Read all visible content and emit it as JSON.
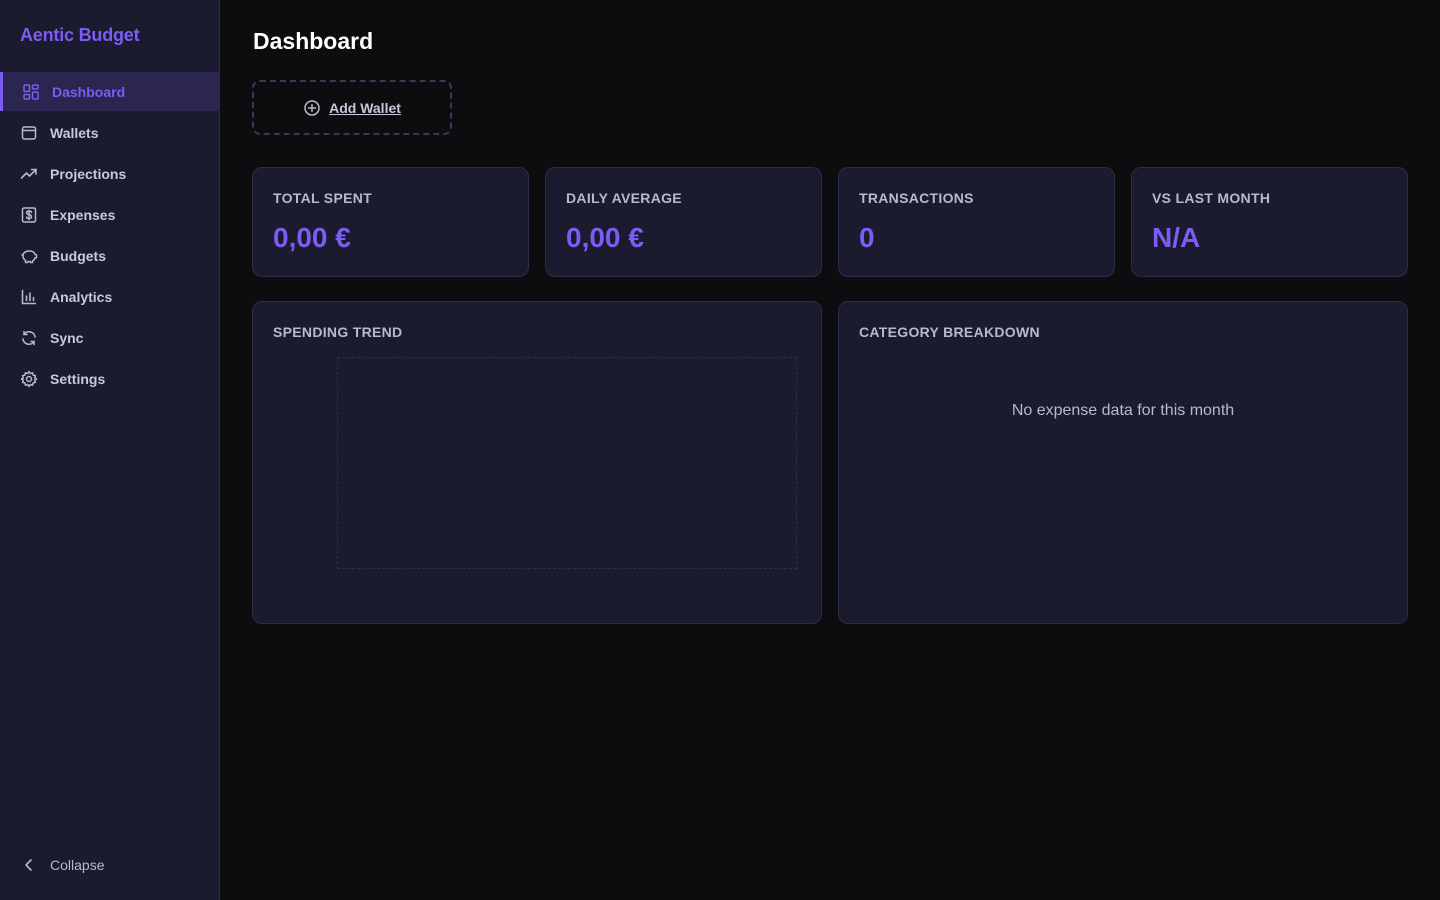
{
  "app": {
    "name": "Aentic Budget"
  },
  "sidebar": {
    "items": [
      {
        "label": "Dashboard",
        "icon": "dashboard-icon",
        "active": true
      },
      {
        "label": "Wallets",
        "icon": "wallet-icon"
      },
      {
        "label": "Projections",
        "icon": "trending-up-icon"
      },
      {
        "label": "Expenses",
        "icon": "receipt-dollar-icon"
      },
      {
        "label": "Budgets",
        "icon": "piggy-bank-icon"
      },
      {
        "label": "Analytics",
        "icon": "bar-chart-icon"
      },
      {
        "label": "Sync",
        "icon": "refresh-icon"
      },
      {
        "label": "Settings",
        "icon": "gear-icon"
      }
    ],
    "collapse_label": "Collapse"
  },
  "main": {
    "title": "Dashboard",
    "add_wallet_label": "Add Wallet",
    "stats": [
      {
        "label": "TOTAL SPENT",
        "value": "0,00 €"
      },
      {
        "label": "DAILY AVERAGE",
        "value": "0,00 €"
      },
      {
        "label": "TRANSACTIONS",
        "value": "0"
      },
      {
        "label": "VS LAST MONTH",
        "value": "N/A"
      }
    ],
    "spending_trend": {
      "title": "SPENDING TREND"
    },
    "category_breakdown": {
      "title": "CATEGORY BREAKDOWN",
      "empty_message": "No expense data for this month"
    }
  },
  "colors": {
    "accent": "#7c5cf2",
    "sidebar_bg": "#1b1b2f",
    "page_bg": "#0d0d0f",
    "card_bg": "#1b1b2f"
  }
}
